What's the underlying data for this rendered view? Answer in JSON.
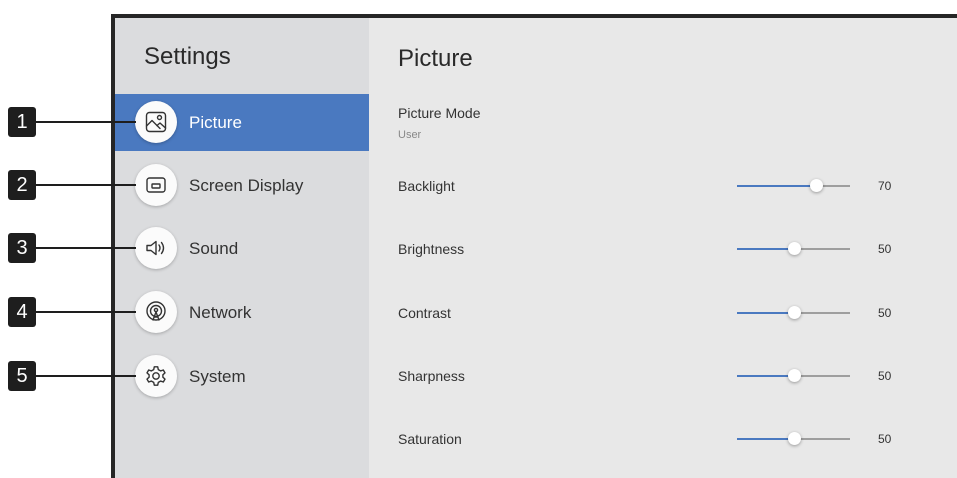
{
  "sidebar": {
    "title": "Settings",
    "items": [
      {
        "label": "Picture",
        "icon": "picture-icon",
        "active": true
      },
      {
        "label": "Screen Display",
        "icon": "screen-display-icon",
        "active": false
      },
      {
        "label": "Sound",
        "icon": "speaker-icon",
        "active": false
      },
      {
        "label": "Network",
        "icon": "network-icon",
        "active": false
      },
      {
        "label": "System",
        "icon": "gear-icon",
        "active": false
      }
    ]
  },
  "main": {
    "title": "Picture",
    "mode": {
      "label": "Picture Mode",
      "value": "User"
    },
    "settings": [
      {
        "label": "Backlight",
        "value": "70",
        "level": 0.7
      },
      {
        "label": "Brightness",
        "value": "50",
        "level": 0.5
      },
      {
        "label": "Contrast",
        "value": "50",
        "level": 0.5
      },
      {
        "label": "Sharpness",
        "value": "50",
        "level": 0.5
      },
      {
        "label": "Saturation",
        "value": "50",
        "level": 0.5
      }
    ]
  },
  "callouts": [
    "1",
    "2",
    "3",
    "4",
    "5"
  ],
  "colors": {
    "accent": "#4a79c0",
    "sidebar": "#dbdcde",
    "main": "#e8e8e8",
    "frame": "#262626"
  }
}
